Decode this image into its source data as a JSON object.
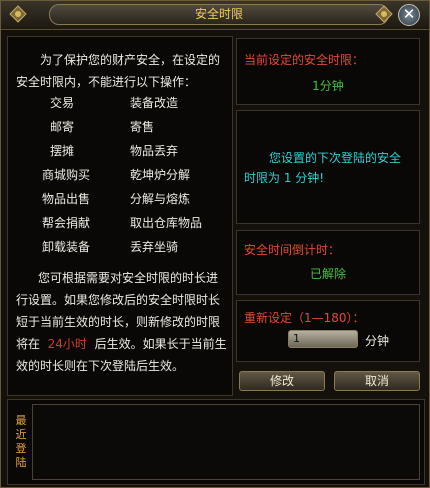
{
  "window": {
    "title": "安全时限",
    "close_glyph": "✕"
  },
  "intro": {
    "line1": "为了保护您的财产安全，在设定的",
    "line2": "安全时限内，不能进行以下操作："
  },
  "operations": [
    [
      "交易",
      "装备改造"
    ],
    [
      "邮寄",
      "寄售"
    ],
    [
      "摆摊",
      "物品丢弃"
    ],
    [
      "商城购买",
      "乾坤炉分解"
    ],
    [
      "物品出售",
      "分解与熔炼"
    ],
    [
      "帮会捐献",
      "取出仓库物品"
    ],
    [
      "卸载装备",
      "丢弃坐骑"
    ]
  ],
  "note": {
    "line1": "您可根据需要对安全时限的时长进",
    "line2": "行设置。如果您修改后的安全时限时长",
    "line3": "短于当前生效的时长，则新修改的时限",
    "line4_pre": "将在",
    "line4_red": "24小时",
    "line4_post": "后生效。如果长于当前生",
    "line5": "效的时长则在下次登陆后生效。"
  },
  "current": {
    "label": "当前设定的安全时限：",
    "value": "1分钟"
  },
  "next": {
    "line1": "您设置的下次登陆的安全",
    "line2": "时限为 1 分钟!"
  },
  "countdown": {
    "label": "安全时间倒计时：",
    "value": "已解除"
  },
  "reset": {
    "label": "重新设定（1—180）：",
    "input_value": "1",
    "unit": "分钟"
  },
  "buttons": {
    "modify": "修改",
    "cancel": "取消"
  },
  "recent_login": {
    "label": "最近登陆"
  },
  "colors": {
    "title": "#f2cd55",
    "red": "#e24a36",
    "green": "#3ec33e",
    "cyan": "#2ad1d4",
    "vertical_label": "#e5a63a"
  }
}
